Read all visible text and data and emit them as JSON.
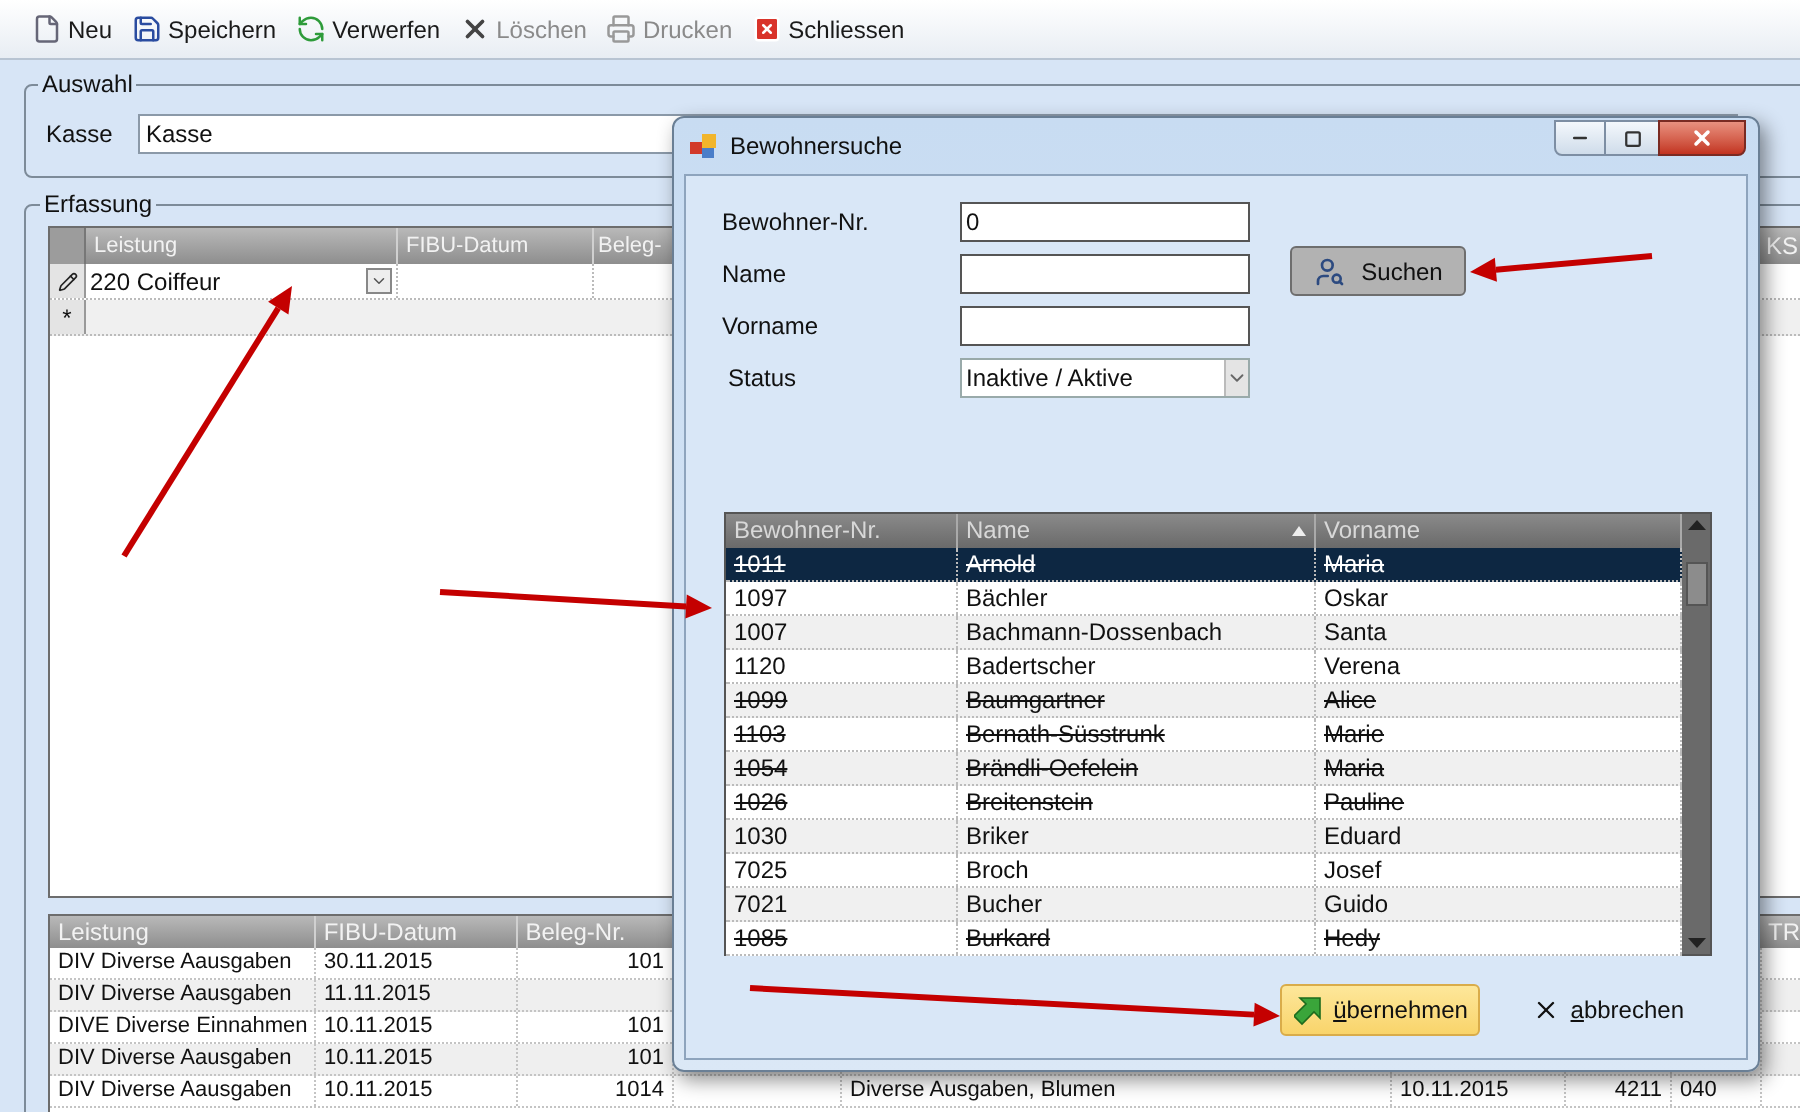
{
  "toolbar": {
    "items": [
      {
        "label": "Neu",
        "disabled": false
      },
      {
        "label": "Speichern",
        "disabled": false
      },
      {
        "label": "Verwerfen",
        "disabled": false
      },
      {
        "label": "Löschen",
        "disabled": true
      },
      {
        "label": "Drucken",
        "disabled": true
      },
      {
        "label": "Schliessen",
        "disabled": false
      }
    ]
  },
  "auswahl": {
    "title": "Auswahl",
    "kasse_label": "Kasse",
    "kasse_value": "Kasse"
  },
  "erfassung": {
    "title": "Erfassung",
    "entry_grid": {
      "columns": [
        "Leistung",
        "FIBU-Datum",
        "Beleg-"
      ],
      "last_column": "KS",
      "rows": [
        {
          "kind": "editing",
          "leistung": "220 Coiffeur"
        },
        {
          "kind": "new",
          "marker": "*"
        }
      ]
    },
    "list_grid": {
      "columns": [
        "Leistung",
        "FIBU-Datum",
        "Beleg-Nr."
      ],
      "last_column": "TR",
      "rows": [
        {
          "leistung": "DIV Diverse Aausgaben",
          "fibu_datum": "30.11.2015",
          "beleg_nr": "101"
        },
        {
          "leistung": "DIV Diverse Aausgaben",
          "fibu_datum": "11.11.2015"
        },
        {
          "leistung": "DIVE Diverse Einnahmen",
          "fibu_datum": "10.11.2015",
          "beleg_nr": "101"
        },
        {
          "leistung": "DIV Diverse Aausgaben",
          "fibu_datum": "10.11.2015",
          "beleg_nr": "101"
        },
        {
          "leistung": "DIV Diverse Aausgaben",
          "fibu_datum": "10.11.2015",
          "beleg_nr": "1014",
          "column_5": "Diverse Ausgaben, Blumen",
          "column_6": "10.11.2015",
          "column_7": "4211",
          "column_8": "040"
        }
      ]
    }
  },
  "dialog": {
    "title": "Bewohnersuche",
    "fields": [
      {
        "label": "Bewohner-Nr.",
        "value": "0"
      },
      {
        "label": "Name"
      },
      {
        "label": "Vorname"
      }
    ],
    "status": {
      "label": "Status",
      "value": "Inaktive / Aktive"
    },
    "search_button": "Suchen",
    "results": {
      "columns": [
        {
          "label": "Bewohner-Nr.",
          "sorted": false
        },
        {
          "label": "Name",
          "sorted": true
        },
        {
          "label": "Vorname",
          "sorted": false
        }
      ],
      "rows": [
        {
          "nr": "1011",
          "name": "Arnold",
          "vorname": "Maria",
          "selected": true,
          "inactive": true
        },
        {
          "nr": "1097",
          "name": "Bächler",
          "vorname": "Oskar",
          "selected": false,
          "inactive": false
        },
        {
          "nr": "1007",
          "name": "Bachmann-Dossenbach",
          "vorname": "Santa",
          "selected": false,
          "inactive": false
        },
        {
          "nr": "1120",
          "name": "Badertscher",
          "vorname": "Verena",
          "selected": false,
          "inactive": false
        },
        {
          "nr": "1099",
          "name": "Baumgartner",
          "vorname": "Alice",
          "selected": false,
          "inactive": true
        },
        {
          "nr": "1103",
          "name": "Bernath-Süsstrunk",
          "vorname": "Marie",
          "selected": false,
          "inactive": true
        },
        {
          "nr": "1054",
          "name": "Brändli-Oefelein",
          "vorname": "Maria",
          "selected": false,
          "inactive": true
        },
        {
          "nr": "1026",
          "name": "Breitenstein",
          "vorname": "Pauline",
          "selected": false,
          "inactive": true
        },
        {
          "nr": "1030",
          "name": "Briker",
          "vorname": "Eduard",
          "selected": false,
          "inactive": false
        },
        {
          "nr": "7025",
          "name": "Broch",
          "vorname": "Josef",
          "selected": false,
          "inactive": false
        },
        {
          "nr": "7021",
          "name": "Bucher",
          "vorname": "Guido",
          "selected": false,
          "inactive": false
        },
        {
          "nr": "1085",
          "name": "Burkard",
          "vorname": "Hedy",
          "selected": false,
          "inactive": true
        }
      ]
    },
    "ok_button": "übernehmen",
    "cancel_button": "abbrechen"
  }
}
